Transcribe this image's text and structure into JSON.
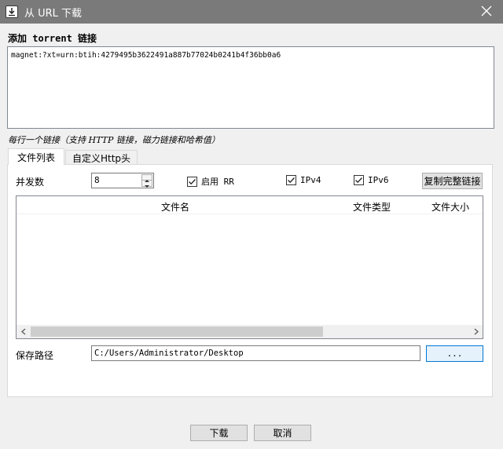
{
  "window": {
    "title": "从 URL 下载",
    "app_icon": "download-app-icon",
    "close_icon": "close-icon"
  },
  "torrent": {
    "section_label": "添加 torrent 链接",
    "link_value": "magnet:?xt=urn:btih:4279495b3622491a887b77024b0241b4f36bb0a6",
    "hint": "每行一个链接（支持 HTTP 链接，磁力链接和哈希值）"
  },
  "tabs": [
    {
      "label": "文件列表",
      "active": true
    },
    {
      "label": "自定义Http头",
      "active": false
    }
  ],
  "options": {
    "concurrency_label": "并发数",
    "concurrency_value": "8",
    "rr": {
      "label": "启用 RR",
      "checked": true
    },
    "ipv4": {
      "label": "IPv4",
      "checked": true
    },
    "ipv6": {
      "label": "IPv6",
      "checked": true
    },
    "copy_button": "复制完整链接"
  },
  "file_list": {
    "columns": [
      "文件名",
      "文件类型",
      "文件大小"
    ],
    "rows": []
  },
  "save": {
    "label": "保存路径",
    "path": "C:/Users/Administrator/Desktop",
    "browse_button": "..."
  },
  "footer": {
    "ok_button": "下载",
    "cancel_button": "取消"
  },
  "colors": {
    "titlebar": "#7a7a7a",
    "window_bg": "#f0f0f0",
    "focus_border": "#0078d7"
  }
}
